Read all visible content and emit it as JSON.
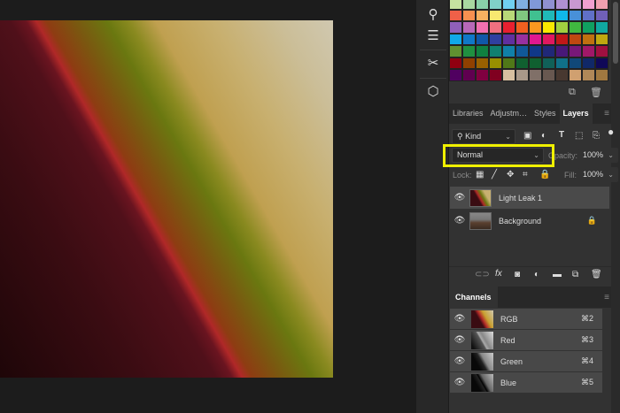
{
  "swatches": [
    "#c5e3a0",
    "#a8d8a0",
    "#88d0a8",
    "#80d0c8",
    "#70d0f0",
    "#80b0e0",
    "#8098d8",
    "#9090d0",
    "#b090d0",
    "#c898d0",
    "#f0a0d0",
    "#f0a0b0",
    "#f06048",
    "#f89050",
    "#f8b060",
    "#f8e870",
    "#b8d878",
    "#80c880",
    "#40c090",
    "#20b8b8",
    "#10b8e8",
    "#4890d8",
    "#6070c8",
    "#7060b8",
    "#9060b8",
    "#b868b8",
    "#f070b0",
    "#f07080",
    "#e82030",
    "#f06020",
    "#f89820",
    "#f8e800",
    "#a0d040",
    "#40b840",
    "#10a060",
    "#10a8a0",
    "#10a8e8",
    "#1078c8",
    "#1058a8",
    "#3040a0",
    "#6030a0",
    "#9830a0",
    "#e01890",
    "#e01860",
    "#c01818",
    "#c04810",
    "#c07010",
    "#c0a810",
    "#609030",
    "#209040",
    "#108040",
    "#108070",
    "#1080a8",
    "#105898",
    "#103888",
    "#202878",
    "#481878",
    "#781878",
    "#a01868",
    "#a01040",
    "#900010",
    "#904000",
    "#986000",
    "#989000",
    "#507818",
    "#106030",
    "#106030",
    "#106058",
    "#107088",
    "#104878",
    "#102868",
    "#100858",
    "#500060",
    "#600050",
    "#800040",
    "#800020",
    "#d8c0a0",
    "#a89888",
    "#807068",
    "#685850",
    "#483830",
    "#d0a070",
    "#b08858",
    "#a07840"
  ],
  "tabs": [
    "Libraries",
    "Adjustm…",
    "Styles",
    "Layers"
  ],
  "active_tab": "Layers",
  "filter": {
    "kind": "Kind"
  },
  "blend_mode": "Normal",
  "opacity": {
    "label": "Opacity:",
    "value": "100%"
  },
  "lock": {
    "label": "Lock:"
  },
  "fill": {
    "label": "Fill:",
    "value": "100%"
  },
  "layers": [
    {
      "name": "Light Leak 1",
      "selected": true
    },
    {
      "name": "Background",
      "locked": true
    }
  ],
  "channels_title": "Channels",
  "channels": [
    {
      "name": "RGB",
      "key": "⌘2"
    },
    {
      "name": "Red",
      "key": "⌘3"
    },
    {
      "name": "Green",
      "key": "⌘4"
    },
    {
      "name": "Blue",
      "key": "⌘5"
    }
  ],
  "highlight_color": "#f0f000"
}
